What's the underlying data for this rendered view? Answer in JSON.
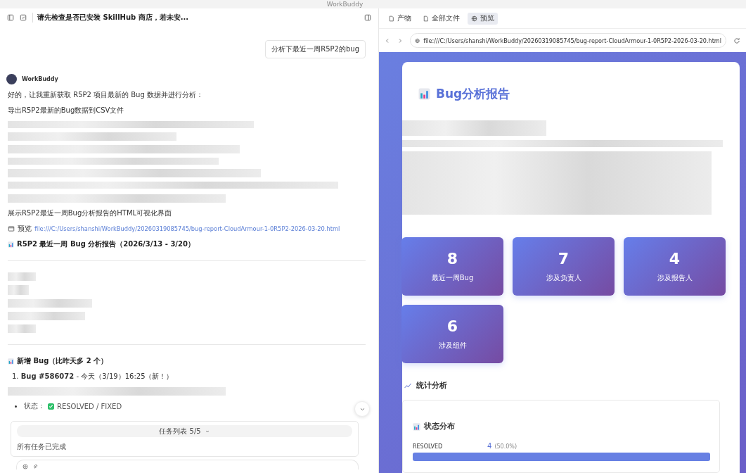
{
  "window": {
    "title": "WorkBuddy"
  },
  "chat": {
    "title": "请先检查是否已安装 SkillHub 商店，若未安...",
    "user_message": "分析下最近一周R5P2的bug",
    "assistant_name": "WorkBuddy",
    "blocks": [
      {
        "kind": "text",
        "text": "好的，让我重新获取 R5P2 项目最新的 Bug 数据并进行分析："
      },
      {
        "kind": "text",
        "text": "导出R5P2最新的Bug数据到CSV文件"
      },
      {
        "kind": "blurred_block"
      },
      {
        "kind": "blurred_line"
      },
      {
        "kind": "text",
        "text": "展示R5P2最近一周Bug分析报告的HTML可视化界面"
      },
      {
        "kind": "preview",
        "label": "预览",
        "link": "file:///C:/Users/shanshi/WorkBuddy/20260319085745/bug-report-CloudArmour-1-0R5P2-2026-03-20.html"
      },
      {
        "kind": "heading",
        "text": "R5P2 最近一周 Bug 分析报告（2026/3/13 - 3/20）"
      },
      {
        "kind": "divider"
      },
      {
        "kind": "blurred_list"
      },
      {
        "kind": "divider"
      },
      {
        "kind": "heading",
        "text": "新增 Bug（比昨天多 2 个）"
      },
      {
        "kind": "numbered",
        "number": "1.",
        "text": "**Bug #586072** - 今天（3/19）16:25（新！）"
      },
      {
        "kind": "blurred_line"
      },
      {
        "kind": "status",
        "label": "状态：",
        "checked": true,
        "text": "RESOLVED / FIXED"
      }
    ],
    "tasks": {
      "header": "任务列表 5/5",
      "expanded": false,
      "summary": "所有任务已完成"
    }
  },
  "preview": {
    "tabs": [
      {
        "label": "产物",
        "selected": false
      },
      {
        "label": "全部文件",
        "selected": false
      },
      {
        "label": "预览",
        "selected": true
      }
    ],
    "url": "file:///C:/Users/shanshi/WorkBuddy/20260319085745/bug-report-CloudArmour-1-0R5P2-2026-03-20.html",
    "report": {
      "title": "Bug分析报告",
      "stats": [
        {
          "value": "8",
          "label": "最近一周Bug"
        },
        {
          "value": "7",
          "label": "涉及负责人"
        },
        {
          "value": "4",
          "label": "涉及报告人"
        },
        {
          "value": "6",
          "label": "涉及组件"
        }
      ],
      "section_title": "统计分析",
      "panel_title": "状态分布",
      "rows": [
        {
          "name": "RESOLVED",
          "count": "4",
          "share": "(50.0%)",
          "level": 1
        }
      ]
    }
  }
}
